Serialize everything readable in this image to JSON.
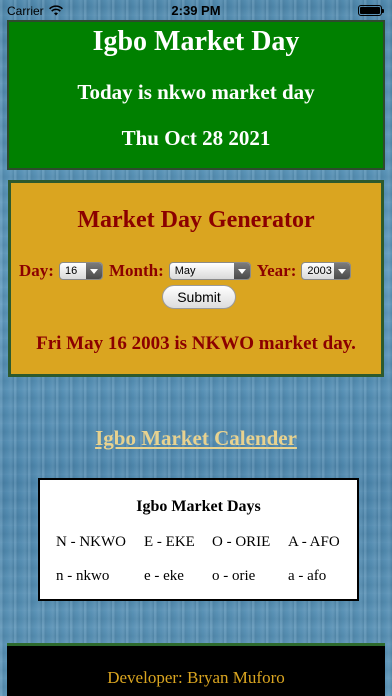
{
  "status_bar": {
    "carrier": "Carrier",
    "time": "2:39 PM",
    "icons": [
      "wifi-icon",
      "battery-icon"
    ]
  },
  "header": {
    "title": "Igbo Market Day",
    "today_text": "Today is nkwo market day",
    "date": "Thu Oct 28 2021"
  },
  "generator": {
    "title": "Market Day Generator",
    "day_label": "Day:",
    "day_value": "16",
    "month_label": "Month:",
    "month_value": "May",
    "year_label": "Year:",
    "year_value": "2003",
    "submit_label": "Submit",
    "result": "Fri May 16 2003 is NKWO market day."
  },
  "calendar_link": "Igbo Market Calender",
  "market_days": {
    "title": "Igbo Market Days",
    "upper": [
      "N - NKWO",
      "E - EKE",
      "O - ORIE",
      "A - AFO"
    ],
    "lower": [
      "n - nkwo",
      "e - eke",
      "o - orie",
      "a - afo"
    ]
  },
  "footer": {
    "developer": "Developer: Bryan Muforo"
  },
  "colors": {
    "header_bg": "#008000",
    "generator_bg": "#DAA520",
    "generator_text": "#8B0000",
    "link": "#E8D28F",
    "footer_bg": "#000000",
    "footer_text": "#DAA520"
  }
}
